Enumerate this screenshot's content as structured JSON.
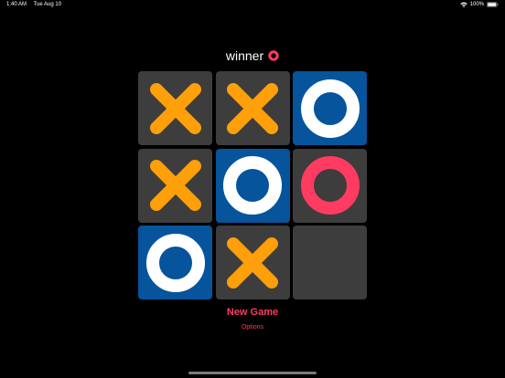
{
  "status_bar": {
    "time": "1:40 AM",
    "date": "Tue Aug 10",
    "battery": "100%",
    "wifi_icon": "wifi-icon",
    "battery_icon": "battery-icon"
  },
  "game": {
    "winner_label": "winner",
    "winner_mark": "O",
    "board": [
      {
        "row": 1,
        "col": 1,
        "mark": "X",
        "highlight": false
      },
      {
        "row": 1,
        "col": 2,
        "mark": "X",
        "highlight": false
      },
      {
        "row": 1,
        "col": 3,
        "mark": "O",
        "highlight": true
      },
      {
        "row": 2,
        "col": 1,
        "mark": "X",
        "highlight": false
      },
      {
        "row": 2,
        "col": 2,
        "mark": "O",
        "highlight": true
      },
      {
        "row": 2,
        "col": 3,
        "mark": "O",
        "highlight": false
      },
      {
        "row": 3,
        "col": 1,
        "mark": "O",
        "highlight": true
      },
      {
        "row": 3,
        "col": 2,
        "mark": "X",
        "highlight": false
      },
      {
        "row": 3,
        "col": 3,
        "mark": "",
        "highlight": false
      }
    ],
    "new_game_label": "New Game",
    "options_label": "Options"
  },
  "colors": {
    "background": "#000000",
    "cell": "#3d3d3d",
    "cell_highlight": "#05549c",
    "x_mark": "#ff9f0a",
    "o_mark": "#ff3b62",
    "o_mark_highlight": "#ffffff",
    "accent": "#ff3b62"
  }
}
